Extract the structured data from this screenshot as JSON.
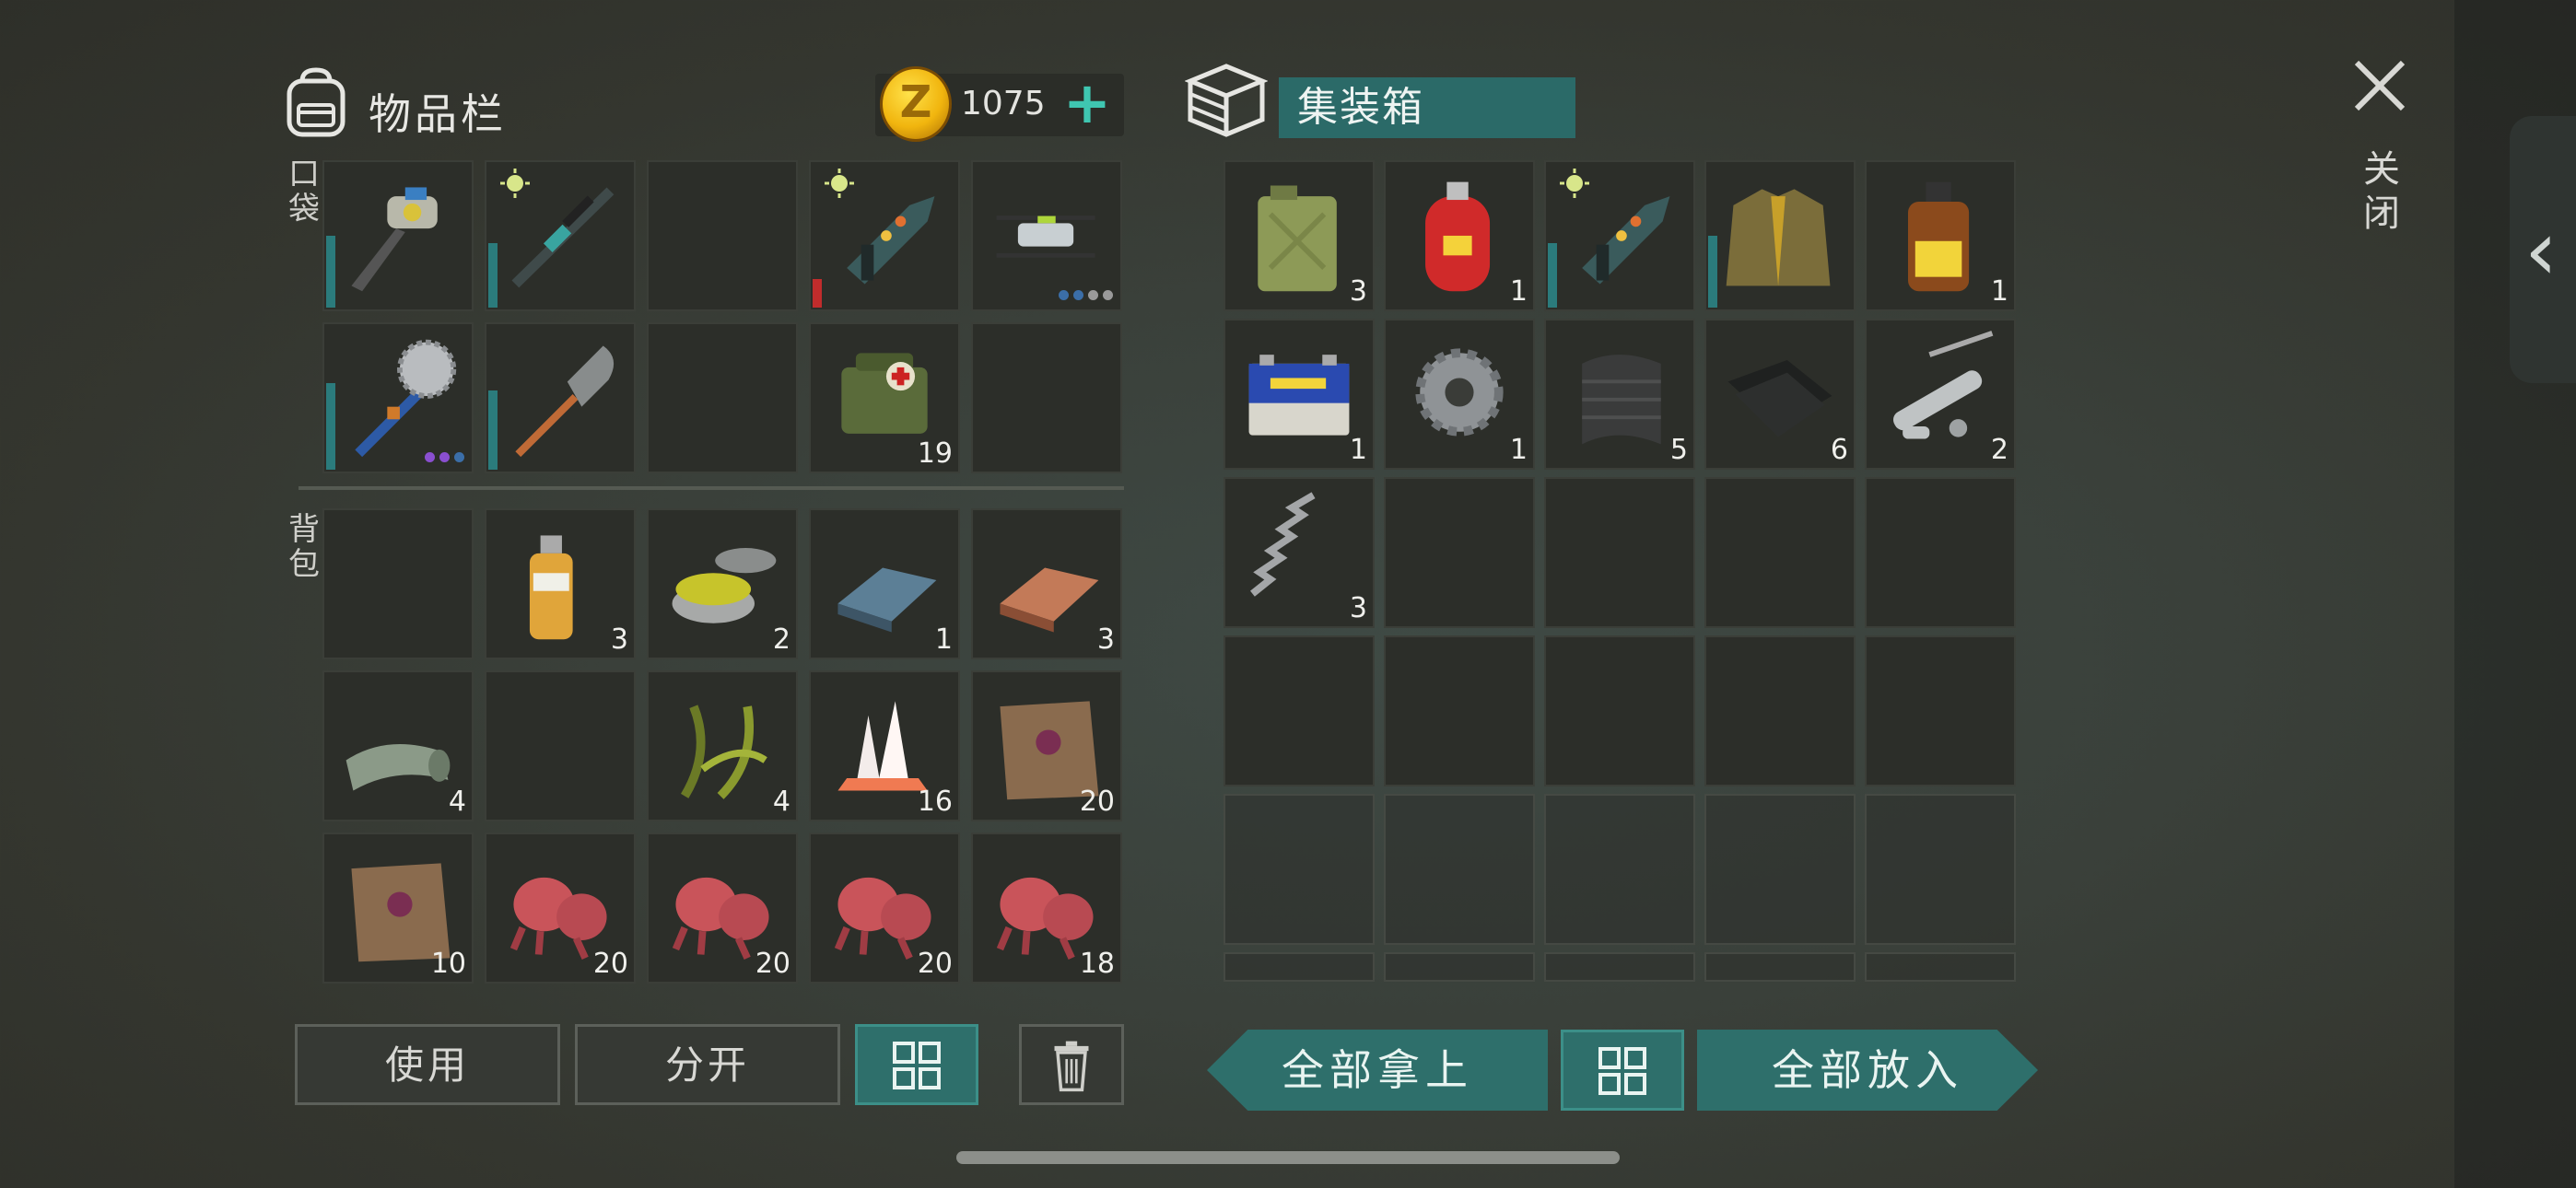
{
  "inventory": {
    "title": "物品栏",
    "coins": "1075",
    "pocket_label": "口袋",
    "backpack_label": "背包",
    "pocket_slots": [
      {
        "item": "auger-drill-icon",
        "qty": "",
        "durability": 0.5
      },
      {
        "item": "rifle-icon",
        "qty": "",
        "durability": 0.45,
        "starred": true
      },
      {
        "item": "",
        "qty": ""
      },
      {
        "item": "plasma-gun-icon",
        "qty": "",
        "durability": 0.2,
        "durability_color": "#c12c2c",
        "starred": true
      },
      {
        "item": "drone-icon",
        "qty": "",
        "dots": [
          "#3b6ea8",
          "#3b6ea8",
          "#9a9a9a",
          "#9a9a9a"
        ]
      },
      {
        "item": "saw-mace-icon",
        "qty": "",
        "durability": 0.6,
        "dots": [
          "#8a4fd0",
          "#8a4fd0",
          "#3b6ea8"
        ]
      },
      {
        "item": "shovel-icon",
        "qty": "",
        "durability": 0.55
      },
      {
        "item": "",
        "qty": ""
      },
      {
        "item": "medkit-bag-icon",
        "qty": "19"
      },
      {
        "item": "",
        "qty": ""
      }
    ],
    "backpack_slots": [
      {
        "item": "",
        "qty": ""
      },
      {
        "item": "oil-bottle-icon",
        "qty": "3"
      },
      {
        "item": "resin-tin-icon",
        "qty": "2"
      },
      {
        "item": "iron-ingot-icon",
        "qty": "1"
      },
      {
        "item": "copper-ingot-icon",
        "qty": "3"
      },
      {
        "item": "scales-roll-icon",
        "qty": "4"
      },
      {
        "item": "",
        "qty": ""
      },
      {
        "item": "herb-icon",
        "qty": "4"
      },
      {
        "item": "crystal-icon",
        "qty": "16"
      },
      {
        "item": "hide-icon",
        "qty": "20"
      },
      {
        "item": "hide-icon",
        "qty": "10"
      },
      {
        "item": "mushroom-icon",
        "qty": "20"
      },
      {
        "item": "mushroom-icon",
        "qty": "20"
      },
      {
        "item": "mushroom-icon",
        "qty": "20"
      },
      {
        "item": "mushroom-icon",
        "qty": "18"
      }
    ],
    "buttons": {
      "use": "使用",
      "split": "分开"
    }
  },
  "container": {
    "title": "集装箱",
    "slots": [
      {
        "item": "jerrycan-icon",
        "qty": "3"
      },
      {
        "item": "gas-cylinder-icon",
        "qty": "1"
      },
      {
        "item": "plasma-gun-icon",
        "qty": "",
        "durability": 0.45,
        "starred": true
      },
      {
        "item": "jacket-icon",
        "qty": "",
        "durability": 0.5
      },
      {
        "item": "medicine-bottle-icon",
        "qty": "1"
      },
      {
        "item": "battery-icon",
        "qty": "1"
      },
      {
        "item": "gear-icon",
        "qty": "1"
      },
      {
        "item": "carbon-sheet-icon",
        "qty": "5"
      },
      {
        "item": "leather-icon",
        "qty": "6"
      },
      {
        "item": "pipe-parts-icon",
        "qty": "2"
      },
      {
        "item": "spring-icon",
        "qty": "3"
      }
    ],
    "buttons": {
      "take_all": "全部拿上",
      "put_all": "全部放入"
    }
  },
  "close_label": "关闭",
  "colors": {
    "accent_teal": "#2e6f6b",
    "plus": "#3fc6b1",
    "coin": "#f1b50e"
  }
}
